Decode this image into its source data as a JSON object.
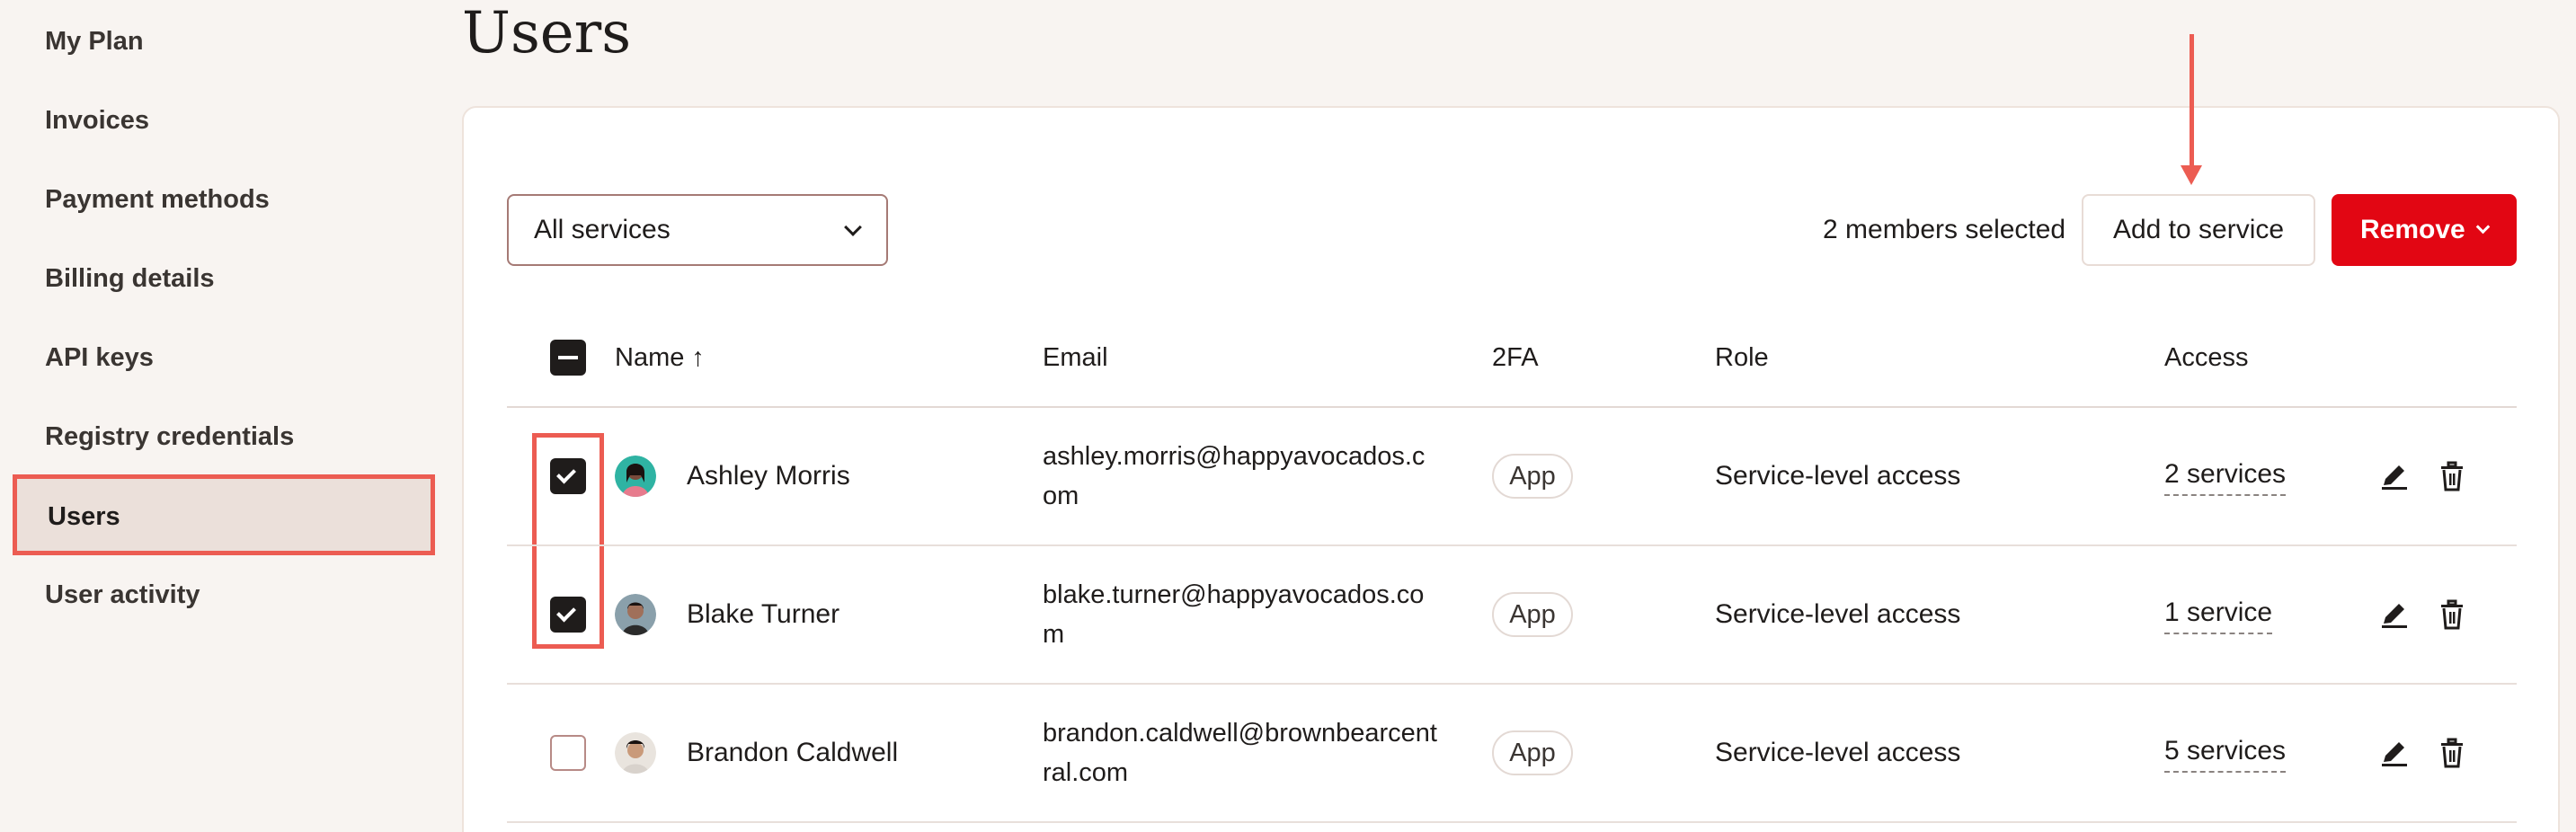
{
  "sidebar": {
    "items": [
      {
        "label": "My Plan"
      },
      {
        "label": "Invoices"
      },
      {
        "label": "Payment methods"
      },
      {
        "label": "Billing details"
      },
      {
        "label": "API keys"
      },
      {
        "label": "Registry credentials"
      },
      {
        "label": "Users",
        "active": true
      },
      {
        "label": "User activity"
      }
    ]
  },
  "page": {
    "title": "Users"
  },
  "toolbar": {
    "filter_value": "All services",
    "selected_text": "2 members selected",
    "add_label": "Add to service",
    "remove_label": "Remove"
  },
  "table": {
    "headers": {
      "name": "Name ↑",
      "email": "Email",
      "twofa": "2FA",
      "role": "Role",
      "access": "Access"
    },
    "rows": [
      {
        "name": "Ashley Morris",
        "email": "ashley.morris@happyavocados.com",
        "twofa": "App",
        "role": "Service-level access",
        "access": "2 services",
        "checked": true
      },
      {
        "name": "Blake Turner",
        "email": "blake.turner@happyavocados.com",
        "twofa": "App",
        "role": "Service-level access",
        "access": "1 service",
        "checked": true
      },
      {
        "name": "Brandon Caldwell",
        "email": "brandon.caldwell@brownbearcentral.com",
        "twofa": "App",
        "role": "Service-level access",
        "access": "5 services",
        "checked": false
      }
    ]
  },
  "colors": {
    "accent": "#e20613",
    "highlight": "#ec5c52",
    "background": "#f8f4f1"
  }
}
